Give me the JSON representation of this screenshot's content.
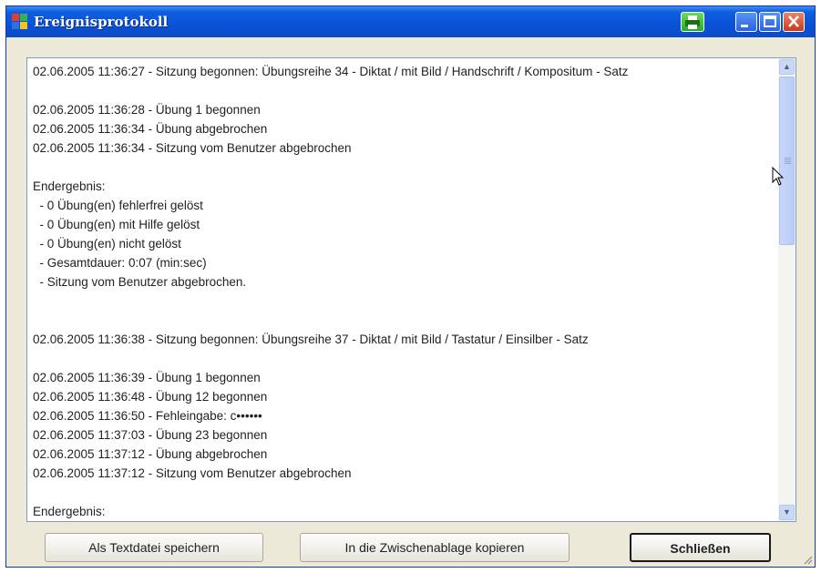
{
  "window": {
    "title": "Ereignisprotokoll"
  },
  "log": {
    "lines": [
      "02.06.2005 11:36:27 - Sitzung begonnen: Übungsreihe 34 - Diktat / mit Bild / Handschrift / Kompositum - Satz",
      "",
      "02.06.2005 11:36:28 - Übung 1 begonnen",
      "02.06.2005 11:36:34 - Übung abgebrochen",
      "02.06.2005 11:36:34 - Sitzung vom Benutzer abgebrochen",
      "",
      "Endergebnis:",
      "  - 0 Übung(en) fehlerfrei gelöst",
      "  - 0 Übung(en) mit Hilfe gelöst",
      "  - 0 Übung(en) nicht gelöst",
      "  - Gesamtdauer: 0:07 (min:sec)",
      "  - Sitzung vom Benutzer abgebrochen.",
      "",
      "",
      "02.06.2005 11:36:38 - Sitzung begonnen: Übungsreihe 37 - Diktat / mit Bild / Tastatur / Einsilber - Satz",
      "",
      "02.06.2005 11:36:39 - Übung 1 begonnen",
      "02.06.2005 11:36:48 - Übung 12 begonnen",
      "02.06.2005 11:36:50 - Fehleingabe: c••••••",
      "02.06.2005 11:37:03 - Übung 23 begonnen",
      "02.06.2005 11:37:12 - Übung abgebrochen",
      "02.06.2005 11:37:12 - Sitzung vom Benutzer abgebrochen",
      "",
      "Endergebnis:"
    ]
  },
  "buttons": {
    "save": "Als Textdatei speichern",
    "copy": "In die Zwischenablage kopieren",
    "close": "Schließen"
  }
}
